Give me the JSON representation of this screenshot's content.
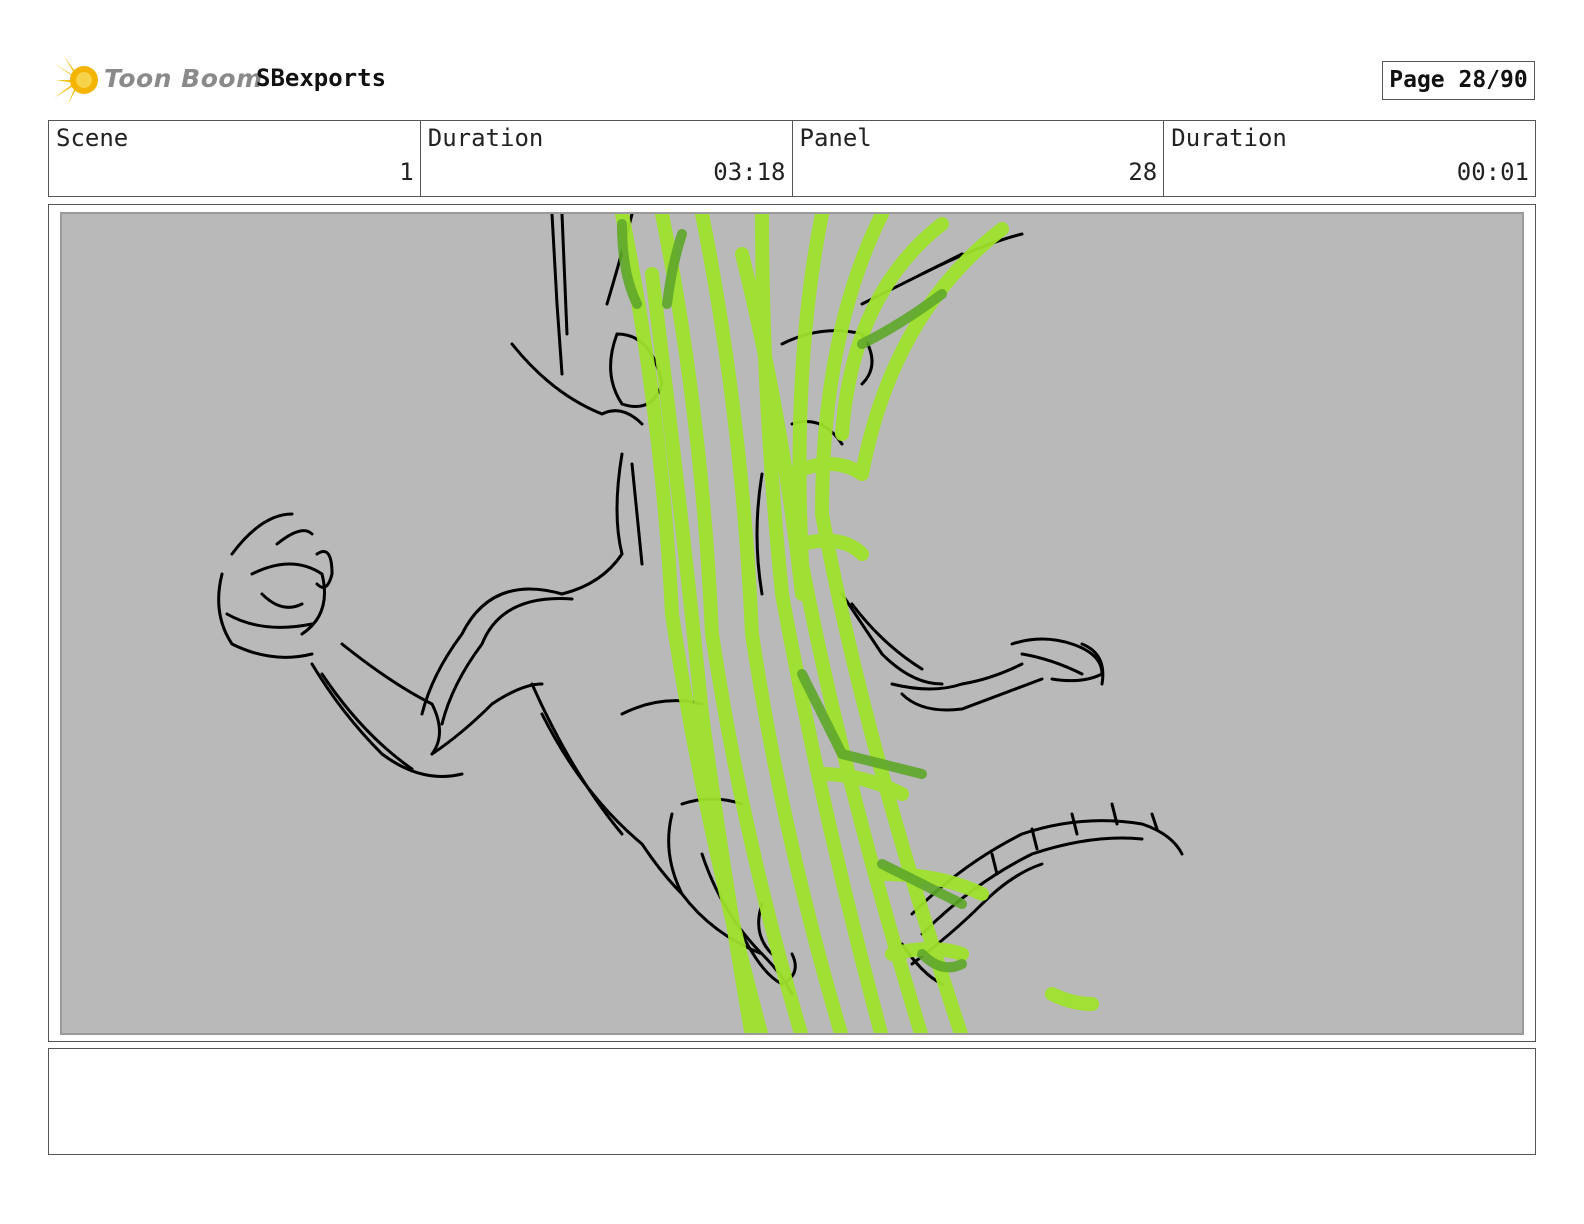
{
  "header": {
    "logo_text": "Toon Boom",
    "project_name": "SBexports",
    "page_label": "Page 28/90"
  },
  "info_table": [
    {
      "label": "Scene",
      "value": "1"
    },
    {
      "label": "Duration",
      "value": "03:18"
    },
    {
      "label": "Panel",
      "value": "28"
    },
    {
      "label": "Duration",
      "value": "00:01"
    }
  ],
  "panel_image": {
    "description_icon": "sketch-image",
    "background_color": "#b9b9b9",
    "stroke_color": "#000000",
    "accent_color": "#9fe22c"
  },
  "notes": {
    "text": ""
  }
}
